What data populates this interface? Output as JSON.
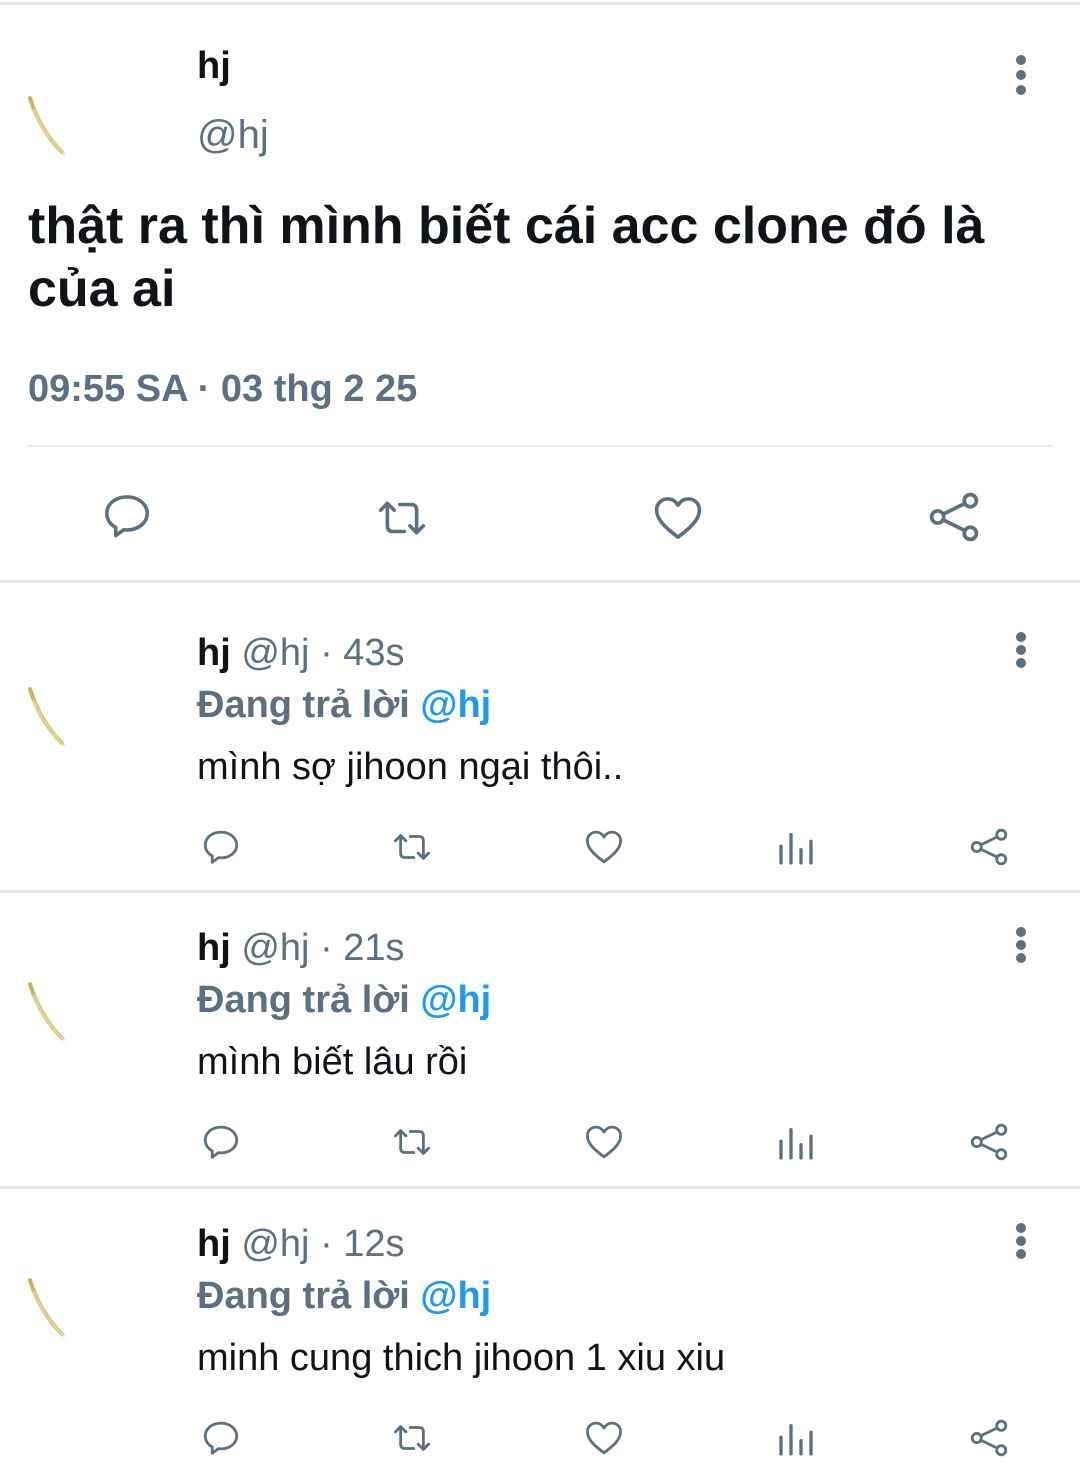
{
  "colors": {
    "text": "#0f1419",
    "secondary": "#5b7083",
    "accent": "#1d9bf0",
    "divider": "#e6e8ea"
  },
  "main": {
    "name": "hj",
    "handle": "@hj",
    "text": "thật ra thì mình biết cái acc clone đó là của ai",
    "timestamp": "09:55 SA · 03 thg 2 25",
    "actions": [
      "reply-icon",
      "retweet-icon",
      "like-icon",
      "share-icon"
    ]
  },
  "replies": [
    {
      "name": "hj",
      "handle": "@hj",
      "time": "· 43s",
      "reply_prefix": "Đang trả lời",
      "reply_mention": "@hj",
      "text": "mình sợ jihoon ngại thôi.."
    },
    {
      "name": "hj",
      "handle": "@hj",
      "time": "· 21s",
      "reply_prefix": "Đang trả lời",
      "reply_mention": "@hj",
      "text": "mình biết lâu rồi"
    },
    {
      "name": "hj",
      "handle": "@hj",
      "time": "· 12s",
      "reply_prefix": "Đang trả lời",
      "reply_mention": "@hj",
      "text": "minh cung thich jihoon 1 xiu xiu"
    }
  ]
}
